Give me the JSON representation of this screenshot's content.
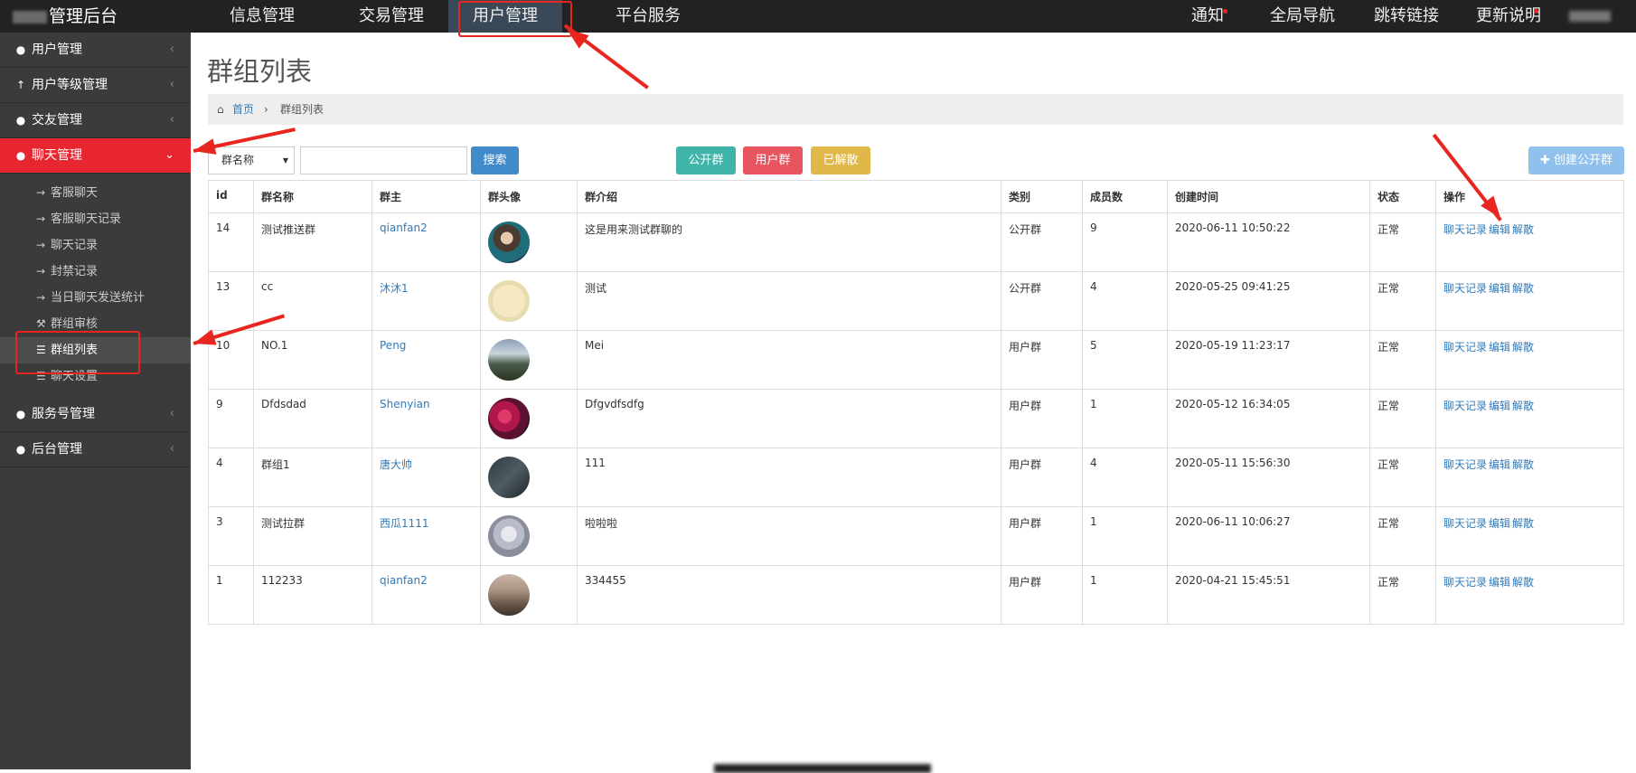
{
  "topbar": {
    "brand": "管理后台",
    "nav": [
      "信息管理",
      "交易管理",
      "用户管理",
      "平台服务"
    ],
    "right": [
      "通知",
      "全局导航",
      "跳转链接",
      "更新说明"
    ]
  },
  "sidebar": {
    "items": [
      {
        "label": "用户管理",
        "icon": "user-icon"
      },
      {
        "label": "用户等级管理",
        "icon": "arrow-up-icon"
      },
      {
        "label": "交友管理",
        "icon": "user-icon"
      },
      {
        "label": "聊天管理",
        "icon": "user-icon"
      },
      {
        "label": "服务号管理",
        "icon": "user-icon"
      },
      {
        "label": "后台管理",
        "icon": "user-icon"
      }
    ],
    "subitems": [
      "客服聊天",
      "客服聊天记录",
      "聊天记录",
      "封禁记录",
      "当日聊天发送统计",
      "群组审核",
      "群组列表",
      "聊天设置"
    ]
  },
  "page": {
    "title": "群组列表",
    "breadcrumb": {
      "home": "首页",
      "current": "群组列表"
    }
  },
  "toolbar": {
    "select_value": "群名称",
    "search_label": "搜索",
    "public_label": "公开群",
    "user_label": "用户群",
    "dissolved_label": "已解散",
    "create_label": "创建公开群"
  },
  "table": {
    "headers": [
      "id",
      "群名称",
      "群主",
      "群头像",
      "群介绍",
      "类别",
      "成员数",
      "创建时间",
      "状态",
      "操作"
    ],
    "ops": [
      "聊天记录",
      "编辑",
      "解散"
    ],
    "rows": [
      {
        "id": "14",
        "name": "测试推送群",
        "owner": "qianfan2",
        "intro": "这是用来测试群聊的",
        "type": "公开群",
        "members": "9",
        "created": "2020-06-11 10:50:22",
        "status": "正常"
      },
      {
        "id": "13",
        "name": "cc",
        "owner": "沐沐1",
        "intro": "测试",
        "type": "公开群",
        "members": "4",
        "created": "2020-05-25 09:41:25",
        "status": "正常"
      },
      {
        "id": "10",
        "name": "NO.1",
        "owner": "Peng",
        "intro": "Mei",
        "type": "用户群",
        "members": "5",
        "created": "2020-05-19 11:23:17",
        "status": "正常"
      },
      {
        "id": "9",
        "name": "Dfdsdad",
        "owner": "Shenyian",
        "intro": "Dfgvdfsdfg",
        "type": "用户群",
        "members": "1",
        "created": "2020-05-12 16:34:05",
        "status": "正常"
      },
      {
        "id": "4",
        "name": "群组1",
        "owner": "唐大帅",
        "intro": "111",
        "type": "用户群",
        "members": "4",
        "created": "2020-05-11 15:56:30",
        "status": "正常"
      },
      {
        "id": "3",
        "name": "测试拉群",
        "owner": "西瓜1111",
        "intro": "啦啦啦",
        "type": "用户群",
        "members": "1",
        "created": "2020-06-11 10:06:27",
        "status": "正常"
      },
      {
        "id": "1",
        "name": "112233",
        "owner": "qianfan2",
        "intro": "334455",
        "type": "用户群",
        "members": "1",
        "created": "2020-04-21 15:45:51",
        "status": "正常"
      }
    ]
  },
  "colors": {
    "topbar": "#222222",
    "sidebar": "#3b3b3b",
    "accent_red": "#e8262f",
    "search": "#428bca",
    "public": "#3fb4a8",
    "user": "#e8555e",
    "dissolved": "#e0b84a",
    "create": "#8fc1ec"
  }
}
